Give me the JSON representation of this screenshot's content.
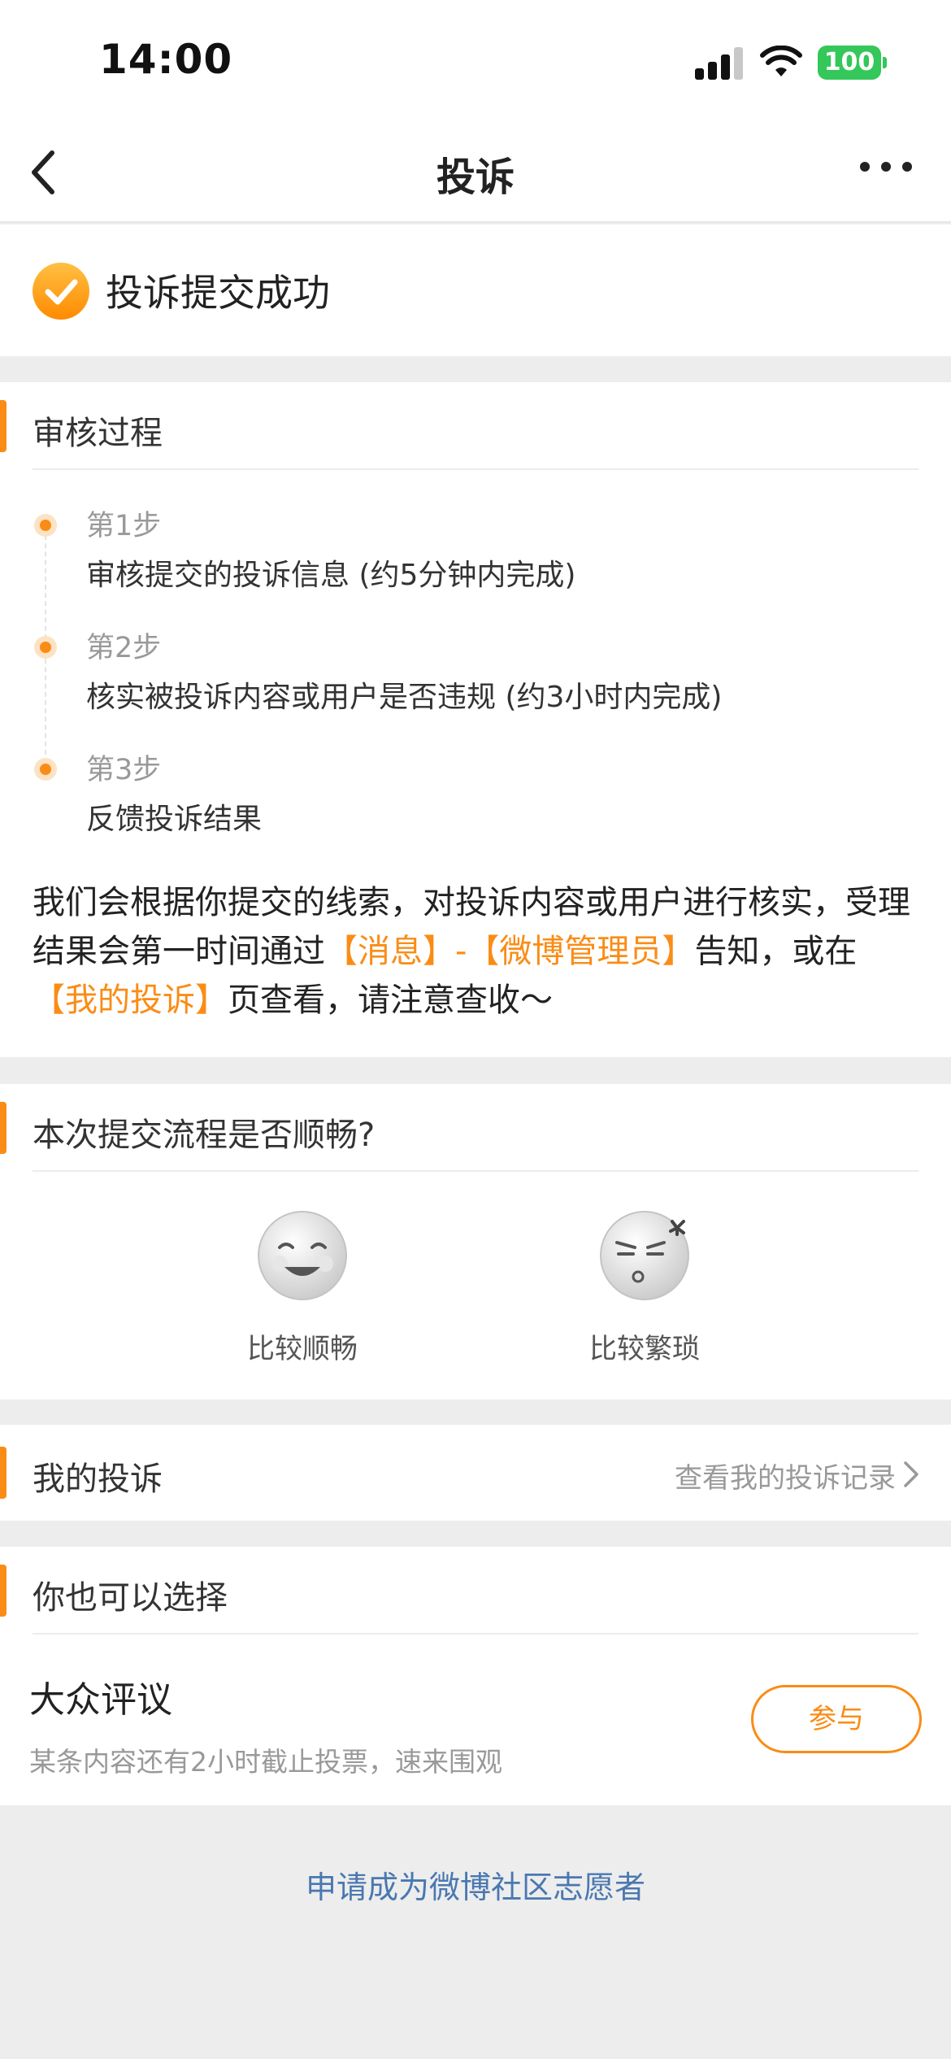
{
  "status_bar": {
    "time": "14:00",
    "battery": "100"
  },
  "nav": {
    "title": "投诉"
  },
  "success": {
    "text": "投诉提交成功"
  },
  "review": {
    "title": "审核过程",
    "steps": [
      {
        "title": "第1步",
        "desc": "审核提交的投诉信息 (约5分钟内完成)"
      },
      {
        "title": "第2步",
        "desc": "核实被投诉内容或用户是否违规 (约3小时内完成)"
      },
      {
        "title": "第3步",
        "desc": "反馈投诉结果"
      }
    ],
    "note": {
      "part1": "我们会根据你提交的线索，对投诉内容或用户进行核实，受理结果会第一时间通过",
      "highlight1": "【消息】-【微博管理员】",
      "part2": "告知，或在",
      "highlight2": "【我的投诉】",
      "part3": "页查看，请注意查收～"
    }
  },
  "feedback": {
    "title": "本次提交流程是否顺畅?",
    "options": [
      {
        "label": "比较顺畅"
      },
      {
        "label": "比较繁琐"
      }
    ]
  },
  "my_complaints": {
    "title": "我的投诉",
    "link": "查看我的投诉记录"
  },
  "options": {
    "title": "你也可以选择",
    "item": {
      "title": "大众评议",
      "desc": "某条内容还有2小时截止投票，速来围观",
      "button": "参与"
    }
  },
  "volunteer_link": "申请成为微博社区志愿者",
  "colors": {
    "accent": "#fa8c16",
    "link": "#4a78b0",
    "battery": "#34c759"
  }
}
